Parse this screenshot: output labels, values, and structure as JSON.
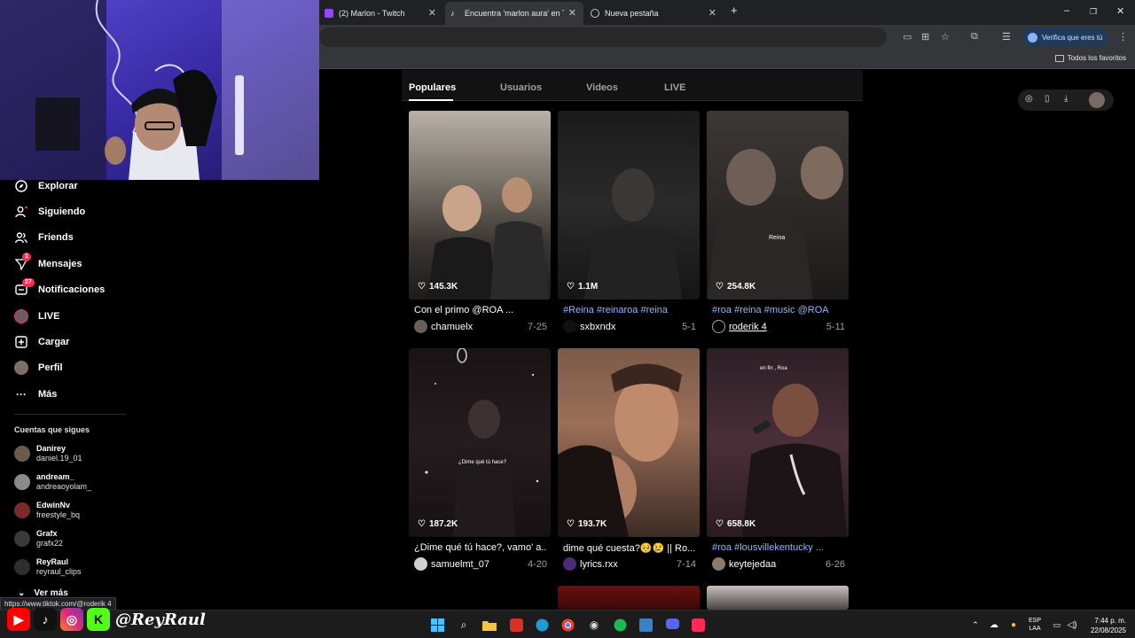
{
  "browser": {
    "tabs": [
      {
        "title": "(2) Marlon - Twitch",
        "active": false
      },
      {
        "title": "Encuentra 'marlon aura' en TikT",
        "active": true
      },
      {
        "title": "Nueva pestaña",
        "active": false
      }
    ],
    "new_tab": "+",
    "window_controls": {
      "minimize": "–",
      "maximize": "❐",
      "close": "✕"
    },
    "profile_pill": "Verifica que eres tú",
    "bookmarks_folder": "Todos los favoritos"
  },
  "sidebar": {
    "items": [
      {
        "label": "Explorar",
        "icon": "compass-icon"
      },
      {
        "label": "Siguiendo",
        "icon": "following-icon"
      },
      {
        "label": "Friends",
        "icon": "friends-icon"
      },
      {
        "label": "Mensajes",
        "icon": "messages-icon",
        "badge": "1"
      },
      {
        "label": "Notificaciones",
        "icon": "inbox-icon",
        "badge": "27"
      },
      {
        "label": "LIVE",
        "icon": "live-icon"
      },
      {
        "label": "Cargar",
        "icon": "upload-icon"
      },
      {
        "label": "Perfil",
        "icon": "profile-icon"
      },
      {
        "label": "Más",
        "icon": "more-icon"
      }
    ],
    "following_title": "Cuentas que sigues",
    "following": [
      {
        "name": "Danirey",
        "handle": "daniel.19_01",
        "avatar_color": "#6b5a4e"
      },
      {
        "name": "andream_",
        "handle": "andreaoyolam_",
        "avatar_color": "#8a8a8a"
      },
      {
        "name": "EdwinNv",
        "handle": "freestyle_bq",
        "avatar_color": "#7a2a2a"
      },
      {
        "name": "Grafx",
        "handle": "grafx22",
        "avatar_color": "#3a3a3a"
      },
      {
        "name": "ReyRaul",
        "handle": "reyraul_clips",
        "avatar_color": "#2e2e2e"
      }
    ],
    "see_more": "Ver más"
  },
  "search_tabs": [
    {
      "label": "Populares",
      "active": true
    },
    {
      "label": "Usuarios",
      "active": false
    },
    {
      "label": "Videos",
      "active": false
    },
    {
      "label": "LIVE",
      "active": false
    }
  ],
  "videos": [
    {
      "likes": "145.3K",
      "caption": "Con el primo @ROA ...",
      "tags": false,
      "author": "chamuelx",
      "date": "7-25"
    },
    {
      "likes": "1.1M",
      "caption": "#Reina #reinaroa #reina",
      "tags": true,
      "author": "sxbxndx",
      "date": "5-1"
    },
    {
      "likes": "254.8K",
      "caption": "#roa #reina #music @ROA",
      "tags": true,
      "author": "roderik 4",
      "date": "5-11",
      "overlay": "Reina"
    },
    {
      "likes": "187.2K",
      "caption": "¿Dime qué tú hace?, vamo' a...",
      "tags": false,
      "author": "samuelmt_07",
      "date": "4-20",
      "overlay": "¿Dime qué tú hace?"
    },
    {
      "likes": "193.7K",
      "caption": "dime qué cuesta?🥺😢 || Ro...",
      "tags": false,
      "author": "lyrics.rxx",
      "date": "7-14"
    },
    {
      "likes": "658.8K",
      "caption": "#roa #lousvillekentucky ...",
      "tags": true,
      "author": "keytejedaa",
      "date": "6-26",
      "overlay": "en fin , Roa"
    }
  ],
  "status_url": "https://www.tiktok.com/@roderik 4",
  "stream_overlay": {
    "handle": "@ReyRaul"
  },
  "taskbar": {
    "lang_line1": "ESP",
    "lang_line2": "LAA",
    "time": "7:44 p. m.",
    "date": "22/08/2025"
  },
  "colors": {
    "tiktok_red": "#fe2c55",
    "tag_blue": "#8fb6ff",
    "chrome_dark": "#202124"
  }
}
